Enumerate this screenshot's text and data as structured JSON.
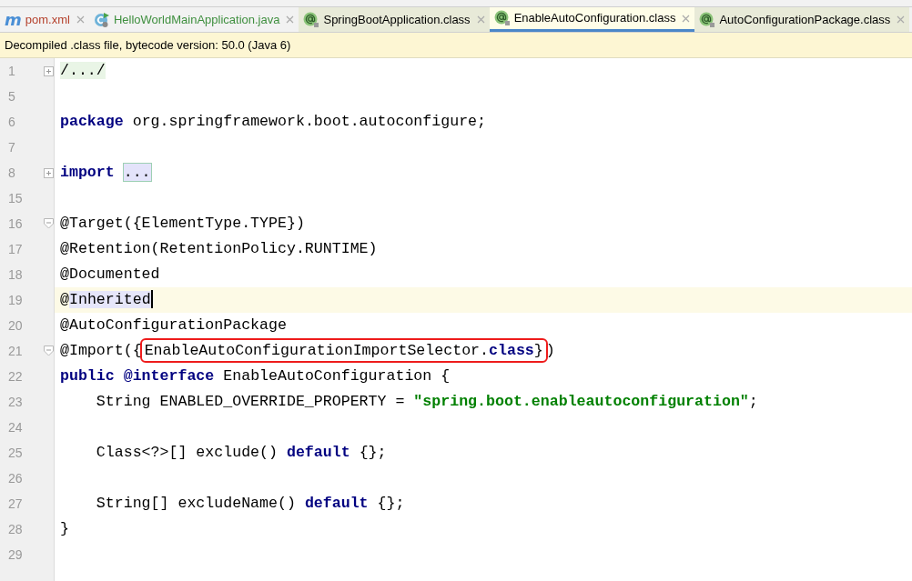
{
  "tabs": [
    {
      "label": "pom.xml",
      "icon_label": "m",
      "kind": "maven",
      "color": "#b5412c",
      "selected": false
    },
    {
      "label": "HelloWorldMainApplication.java",
      "kind": "app-class",
      "color": "#3f8f3f",
      "selected": false
    },
    {
      "label": "SpringBootApplication.class",
      "kind": "library-class",
      "color": "#000000",
      "selected": false
    },
    {
      "label": "EnableAutoConfiguration.class",
      "kind": "library-class",
      "color": "#000000",
      "selected": true
    },
    {
      "label": "AutoConfigurationPackage.class",
      "kind": "library-class",
      "color": "#000000",
      "selected": false
    }
  ],
  "banner": "Decompiled .class file, bytecode version: 50.0 (Java 6)",
  "lines": [
    {
      "number": "1",
      "fold_collapsed": true,
      "current": false,
      "tokens": [
        {
          "text": "/.../",
          "kind": "fold"
        }
      ]
    },
    {
      "number": "5",
      "current": false
    },
    {
      "number": "6",
      "current": false,
      "tokens": [
        {
          "text": "package",
          "kind": "keyword"
        },
        {
          "text": " org.springframework.boot.autoconfigure;",
          "kind": "plain"
        }
      ]
    },
    {
      "number": "7",
      "current": false
    },
    {
      "number": "8",
      "fold_collapsed": true,
      "current": false,
      "tokens": [
        {
          "text": "import",
          "kind": "keyword"
        },
        {
          "text": "...",
          "kind": "fold-boxed",
          "gap_before": true
        }
      ]
    },
    {
      "number": "15",
      "current": false
    },
    {
      "number": "16",
      "fold_collapsed": false,
      "current": false,
      "tokens": [
        {
          "text": "@Target({ElementType.TYPE})",
          "kind": "plain"
        }
      ]
    },
    {
      "number": "17",
      "current": false,
      "tokens": [
        {
          "text": "@Retention(RetentionPolicy.RUNTIME)",
          "kind": "plain"
        }
      ]
    },
    {
      "number": "18",
      "current": false,
      "tokens": [
        {
          "text": "@Documented",
          "kind": "plain"
        }
      ]
    },
    {
      "number": "19",
      "current": true,
      "tokens": [
        {
          "text": "@",
          "kind": "plain"
        },
        {
          "text": "Inherited",
          "kind": "usage"
        },
        {
          "kind": "caret"
        }
      ]
    },
    {
      "number": "20",
      "current": false,
      "tokens": [
        {
          "text": "@AutoConfigurationPackage",
          "kind": "plain"
        }
      ]
    },
    {
      "number": "21",
      "fold_collapsed": false,
      "current": false,
      "tokens": [
        {
          "text": "@Import({",
          "kind": "plain"
        },
        {
          "text": "EnableAutoConfigurationImportSelector.",
          "kind": "plain",
          "boxed": true
        },
        {
          "text": "class",
          "kind": "keyword",
          "boxed": true
        },
        {
          "text": "}",
          "kind": "plain",
          "boxed": true
        },
        {
          "text": ")",
          "kind": "plain"
        }
      ]
    },
    {
      "number": "22",
      "current": false,
      "tokens": [
        {
          "text": "public",
          "kind": "keyword"
        },
        {
          "text": "@interface",
          "kind": "keyword",
          "gap_before": true
        },
        {
          "text": " EnableAutoConfiguration {",
          "kind": "plain"
        }
      ]
    },
    {
      "number": "23",
      "current": false,
      "tokens": [
        {
          "text": "    String ENABLED_OVERRIDE_PROPERTY = ",
          "kind": "plain"
        },
        {
          "text": "\"spring.boot.enableautoconfiguration\"",
          "kind": "string"
        },
        {
          "text": ";",
          "kind": "plain"
        }
      ]
    },
    {
      "number": "24",
      "current": false
    },
    {
      "number": "25",
      "current": false,
      "tokens": [
        {
          "text": "    Class<?>[] exclude() ",
          "kind": "plain"
        },
        {
          "text": "default",
          "kind": "keyword"
        },
        {
          "text": " {};",
          "kind": "plain"
        }
      ]
    },
    {
      "number": "26",
      "current": false
    },
    {
      "number": "27",
      "current": false,
      "tokens": [
        {
          "text": "    String[] excludeName() ",
          "kind": "plain"
        },
        {
          "text": "default",
          "kind": "keyword"
        },
        {
          "text": " {};",
          "kind": "plain"
        }
      ]
    },
    {
      "number": "28",
      "current": false,
      "tokens": [
        {
          "text": "}",
          "kind": "plain"
        }
      ]
    },
    {
      "number": "29",
      "current": false
    }
  ]
}
